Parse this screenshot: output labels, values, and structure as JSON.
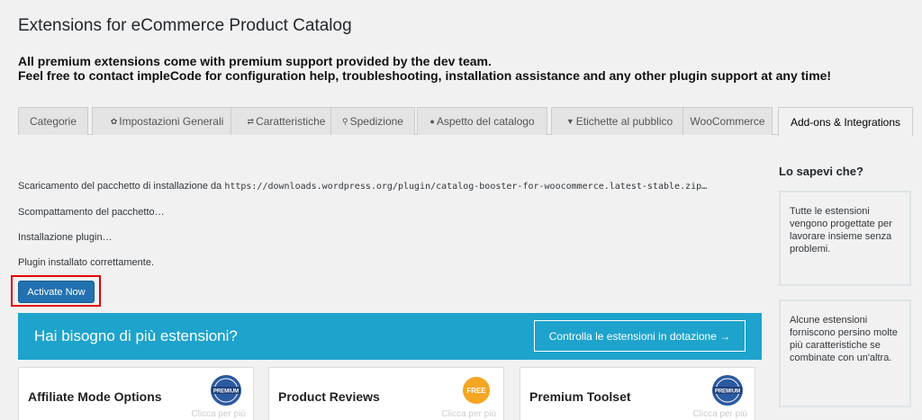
{
  "page": {
    "title": "Extensions for eCommerce Product Catalog",
    "intro_line1": "All premium extensions come with premium support provided by the dev team.",
    "intro_line2": "Feel free to contact impleCode for configuration help, troubleshooting, installation assistance and any other plugin support at any time!"
  },
  "tabs": [
    {
      "label": "Categorie",
      "icon": ""
    },
    {
      "label": "Impostazioni Generali",
      "icon": "gear-icon"
    },
    {
      "label": "Caratteristiche",
      "icon": "shuffle-icon"
    },
    {
      "label": "Spedizione",
      "icon": "location-pin-icon"
    },
    {
      "label": "Aspetto del catalogo",
      "icon": "paint-icon"
    },
    {
      "label": "Etichette al pubblico",
      "icon": "speech-bubble-icon"
    },
    {
      "label": "WooCommerce",
      "icon": ""
    },
    {
      "label": "Add-ons & Integrations",
      "icon": ""
    }
  ],
  "active_tab": "Add-ons & Integrations",
  "install_log": {
    "download_text": "Scaricamento del pacchetto di installazione da",
    "download_url": "https://downloads.wordpress.org/plugin/catalog-booster-for-woocommerce.latest-stable.zip…",
    "unpack": "Scompattamento del pacchetto…",
    "install": "Installazione plugin…",
    "success": "Plugin installato correttamente."
  },
  "activate_button": "Activate Now",
  "banner": {
    "title": "Hai bisogno di più estensioni?",
    "button": "Controlla le estensioni in dotazione →"
  },
  "cards": [
    {
      "title": "Affiliate Mode Options",
      "badge": "PREMIUM",
      "more": "Clicca per più"
    },
    {
      "title": "Product Reviews",
      "badge": "FREE",
      "more": "Clicca per più"
    },
    {
      "title": "Premium Toolset",
      "badge": "PREMIUM",
      "more": "Clicca per più"
    }
  ],
  "sidebar": {
    "title": "Lo sapevi che?",
    "tips": [
      "Tutte le estensioni vengono progettate per lavorare insieme senza problemi.",
      "Alcune estensioni forniscono persino molte più caratteristiche se combinate con un'altra."
    ]
  },
  "colors": {
    "banner": "#1ea3cc",
    "primary_button": "#2271b1",
    "highlight_border": "#e00000",
    "premium_badge": "#2c5aa0",
    "free_badge": "#f5a623"
  }
}
